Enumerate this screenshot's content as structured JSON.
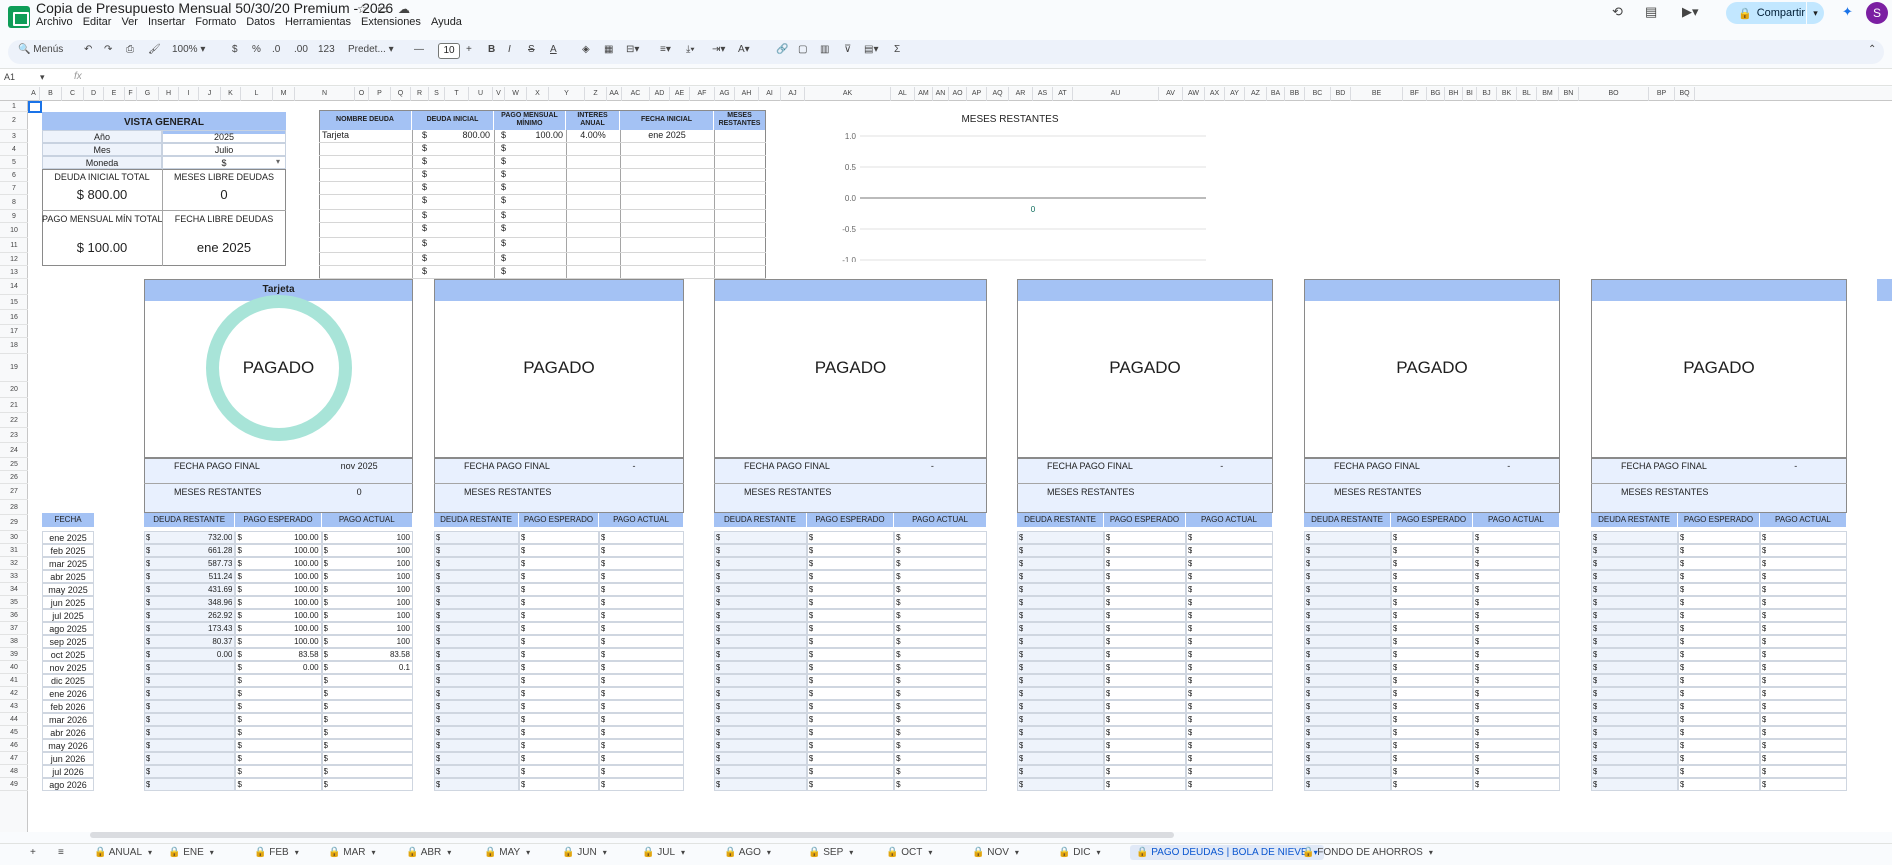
{
  "app": {
    "title": "Copia de Presupuesto Mensual 50/30/20 Premium - 2026",
    "menus": [
      "Archivo",
      "Editar",
      "Ver",
      "Insertar",
      "Formato",
      "Datos",
      "Herramientas",
      "Extensiones",
      "Ayuda"
    ],
    "share": "Compartir",
    "avatar": "S"
  },
  "toolbar": {
    "search": "Menús",
    "zoom": "100%",
    "currency": "$",
    "percent": "%",
    "dec_less": ".0",
    "dec_more": ".00",
    "format123": "123",
    "font": "Predet...",
    "font_size": "10"
  },
  "formula": {
    "cell": "A1",
    "fx": "fx"
  },
  "columns": [
    "A",
    "B",
    "C",
    "D",
    "E",
    "F",
    "G",
    "H",
    "I",
    "J",
    "K",
    "L",
    "M",
    "N",
    "O",
    "P",
    "Q",
    "R",
    "S",
    "T",
    "U",
    "V",
    "W",
    "X",
    "Y",
    "Z",
    "AA",
    "AC",
    "AD",
    "AE",
    "AF",
    "AG",
    "AH",
    "AI",
    "AJ",
    "AK",
    "AL",
    "AM",
    "AN",
    "AO",
    "AP",
    "AQ",
    "AR",
    "AS",
    "AT",
    "AU",
    "AV",
    "AW",
    "AX",
    "AY",
    "AZ",
    "BA",
    "BB",
    "BC",
    "BD",
    "BE",
    "BF",
    "BG",
    "BH",
    "BI",
    "BJ",
    "BK",
    "BL",
    "BM",
    "BN",
    "BO",
    "BP",
    "BQ"
  ],
  "rows": [
    "1",
    "2",
    "3",
    "4",
    "5",
    "6",
    "7",
    "8",
    "9",
    "10",
    "11",
    "12",
    "13",
    "14",
    "15",
    "16",
    "17",
    "18",
    "19",
    "20",
    "21",
    "22",
    "23",
    "24",
    "25",
    "26",
    "27",
    "28",
    "29",
    "30",
    "31",
    "32",
    "33",
    "34",
    "35",
    "36",
    "37",
    "38",
    "39",
    "40",
    "41",
    "42",
    "43",
    "44",
    "45",
    "46",
    "47",
    "48",
    "49"
  ],
  "overview": {
    "title": "VISTA GENERAL",
    "rows": [
      {
        "k": "Año",
        "v": "2025"
      },
      {
        "k": "Mes",
        "v": "Julio"
      },
      {
        "k": "Moneda",
        "v": "$"
      }
    ],
    "deuda_total_label": "DEUDA INICIAL TOTAL",
    "deuda_total": "$ 800.00",
    "meses_libre_label": "MESES LIBRE DEUDAS",
    "meses_libre": "0",
    "pago_min_label": "PAGO MENSUAL MÍN TOTAL",
    "pago_min": "$ 100.00",
    "fecha_libre_label": "FECHA LIBRE DEUDAS",
    "fecha_libre": "ene 2025"
  },
  "debts": {
    "headers": [
      "NOMBRE DEUDA",
      "DEUDA INICIAL",
      "PAGO MENSUAL MÍNIMO",
      "INTERES ANUAL",
      "FECHA INICIAL",
      "MESES RESTANTES"
    ],
    "first": {
      "name": "Tarjeta",
      "cur": "$",
      "deuda": "800.00",
      "cur2": "$",
      "pago": "100.00",
      "interes": "4.00%",
      "fecha": "ene 2025"
    },
    "blank_cur": "$"
  },
  "chart": {
    "title": "MESES RESTANTES",
    "yticks": [
      "1.0",
      "0.5",
      "0.0",
      "-0.5",
      "-1.0"
    ],
    "point_label": "0"
  },
  "cards": [
    {
      "name": "Tarjeta",
      "status": "PAGADO",
      "fecha_label": "FECHA PAGO FINAL",
      "fecha": "nov 2025",
      "meses_label": "MESES RESTANTES",
      "meses": "0"
    },
    {
      "name": "",
      "status": "PAGADO",
      "fecha_label": "FECHA PAGO FINAL",
      "fecha": "-",
      "meses_label": "MESES RESTANTES",
      "meses": ""
    },
    {
      "name": "",
      "status": "PAGADO",
      "fecha_label": "FECHA PAGO FINAL",
      "fecha": "-",
      "meses_label": "MESES RESTANTES",
      "meses": ""
    },
    {
      "name": "",
      "status": "PAGADO",
      "fecha_label": "FECHA PAGO FINAL",
      "fecha": "-",
      "meses_label": "MESES RESTANTES",
      "meses": ""
    },
    {
      "name": "",
      "status": "PAGADO",
      "fecha_label": "FECHA PAGO FINAL",
      "fecha": "-",
      "meses_label": "MESES RESTANTES",
      "meses": ""
    },
    {
      "name": "",
      "status": "PAGADO",
      "fecha_label": "FECHA PAGO FINAL",
      "fecha": "-",
      "meses_label": "MESES RESTANTES",
      "meses": ""
    }
  ],
  "table": {
    "fecha_header": "FECHA",
    "col_headers": [
      "DEUDA RESTANTE",
      "PAGO ESPERADO",
      "PAGO ACTUAL"
    ],
    "cur": "$",
    "months": [
      "ene 2025",
      "feb 2025",
      "mar 2025",
      "abr 2025",
      "may 2025",
      "jun 2025",
      "jul 2025",
      "ago 2025",
      "sep 2025",
      "oct 2025",
      "nov 2025",
      "dic 2025",
      "ene 2026",
      "feb 2026",
      "mar 2026",
      "abr 2026",
      "may 2026",
      "jun 2026",
      "jul 2026",
      "ago 2026"
    ],
    "restante": [
      "732.00",
      "661.28",
      "587.73",
      "511.24",
      "431.69",
      "348.96",
      "262.92",
      "173.43",
      "80.37",
      "0.00",
      "",
      "",
      "",
      "",
      "",
      "",
      "",
      "",
      "",
      ""
    ],
    "esperado": [
      "100.00",
      "100.00",
      "100.00",
      "100.00",
      "100.00",
      "100.00",
      "100.00",
      "100.00",
      "100.00",
      "83.58",
      "0.00",
      "",
      "",
      "",
      "",
      "",
      "",
      "",
      "",
      ""
    ],
    "actual": [
      "100",
      "100",
      "100",
      "100",
      "100",
      "100",
      "100",
      "100",
      "100",
      "83.58",
      "0.1",
      "",
      "",
      "",
      "",
      "",
      "",
      "",
      "",
      ""
    ]
  },
  "sheets": [
    "ANUAL",
    "ENE",
    "FEB",
    "MAR",
    "ABR",
    "MAY",
    "JUN",
    "JUL",
    "AGO",
    "SEP",
    "OCT",
    "NOV",
    "DIC",
    "PAGO DEUDAS | BOLA DE NIEVE",
    "FONDO DE AHORROS"
  ],
  "active_sheet": "PAGO DEUDAS | BOLA DE NIEVE",
  "colors": {
    "header_blue": "#a4c2f4",
    "light_blue": "#e8f0fe",
    "ring": "#a8e4d8",
    "accent": "#0b57d0"
  }
}
